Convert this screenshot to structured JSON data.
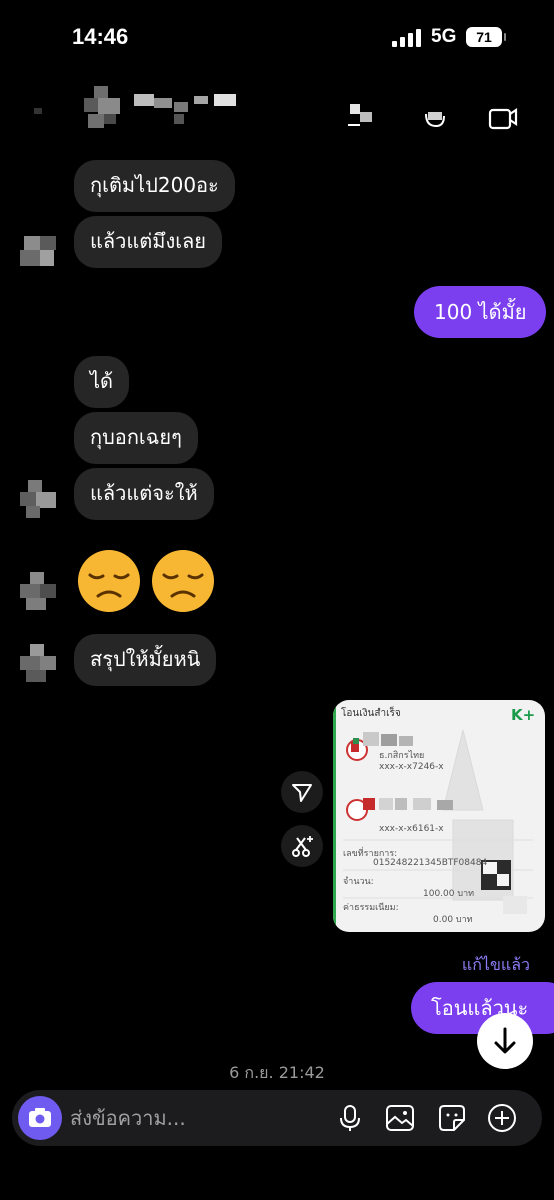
{
  "status": {
    "time": "14:46",
    "network": "5G",
    "battery": "71"
  },
  "messages": [
    {
      "side": "in",
      "text": "กุเติมไป200อะ"
    },
    {
      "side": "in",
      "text": "แล้วแต่มึงเลย"
    },
    {
      "side": "out",
      "text": "100 ได้มั้ย"
    },
    {
      "side": "in",
      "text": "ได้"
    },
    {
      "side": "in",
      "text": "กุบอกเฉยๆ"
    },
    {
      "side": "in",
      "text": "แล้วแต่จะให้"
    },
    {
      "side": "in",
      "text": "สรุปให้มั้ยหนิ"
    },
    {
      "side": "out",
      "text": "โอนแล้วนะ"
    }
  ],
  "emojis": [
    "disappointed-face",
    "disappointed-face"
  ],
  "receipt": {
    "title": "โอนเงินสำเร็จ",
    "brand": "K+",
    "bank_from": "ธ.กสิกรไทย",
    "account_from": "xxx-x-x7246-x",
    "account_to": "xxx-x-x6161-x",
    "ref_label": "เลขที่รายการ:",
    "ref_no": "015248221345BTF08484",
    "amount_label": "จำนวน:",
    "amount": "100.00 บาท",
    "fee_label": "ค่าธรรมเนียม:",
    "fee": "0.00 บาท"
  },
  "edited_label": "แก้ไขแล้ว",
  "date_stamp": "6 ก.ย. 21:42",
  "composer": {
    "placeholder": "ส่งข้อความ..."
  },
  "colors": {
    "incoming_bubble": "#262626",
    "outgoing_bubble": "#7b3ff0",
    "accent": "#6f5bf0"
  },
  "icons": [
    "back-icon",
    "call-icon",
    "video-icon",
    "share-icon",
    "sparkle-icon",
    "camera-icon",
    "mic-icon",
    "gallery-icon",
    "sticker-icon",
    "plus-icon",
    "arrow-down-icon"
  ]
}
